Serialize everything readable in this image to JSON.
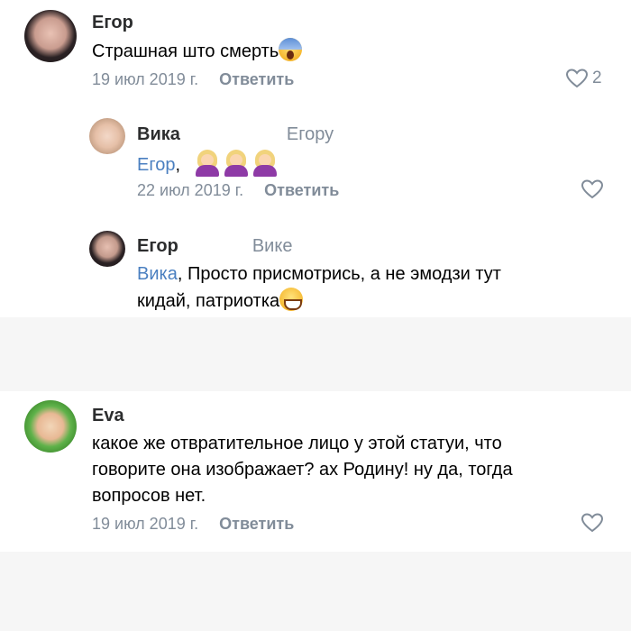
{
  "comments": [
    {
      "author": "Егор",
      "text_lines": [
        "Страшная што смерть"
      ],
      "date": "19 июл 2019 г.",
      "reply_label": "Ответить",
      "likes": "2"
    },
    {
      "author": "Вика",
      "reply_to": "Егору",
      "mention": "Егор",
      "text_after_mention": ",",
      "date": "22 июл 2019 г.",
      "reply_label": "Ответить"
    },
    {
      "author": "Егор",
      "reply_to": "Вике",
      "mention": "Вика",
      "text_line1": ", Просто присмотрись, а не эмодзи тут",
      "text_line2": "кидай, патриотка"
    },
    {
      "author": "Eva",
      "text_lines": [
        "какое же отвратительное лицо у этой статуи, что",
        "говорите она изображает? ах Родину! ну да, тогда",
        "вопросов нет."
      ],
      "date": "19 июл 2019 г.",
      "reply_label": "Ответить"
    }
  ],
  "colors": {
    "link": "#4a7fc0",
    "secondary": "#818c99",
    "separator": "#f6f6f6"
  },
  "icons": [
    "heart-icon",
    "face-screaming-emoji",
    "woman-facepalming-emoji",
    "grinning-emoji"
  ]
}
